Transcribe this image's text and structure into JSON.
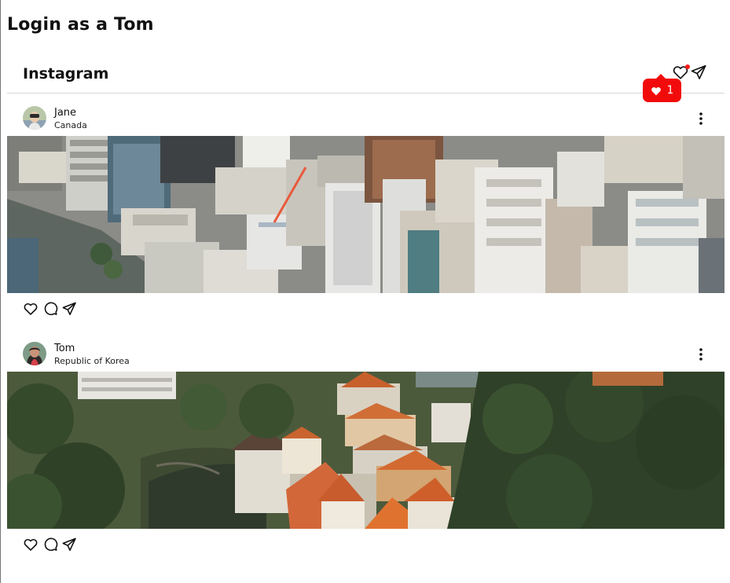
{
  "page": {
    "heading": "Login as a Tom"
  },
  "app": {
    "title": "Instagram",
    "icons": [
      "heart-icon",
      "send-icon"
    ],
    "notification": {
      "count": "1",
      "color": "#f20b0b",
      "has_unread_dot": true
    }
  },
  "posts": [
    {
      "username": "Jane",
      "location": "Canada",
      "photo": "aerial view of downtown skyscrapers",
      "actions": [
        "like-icon",
        "comment-icon",
        "share-icon"
      ]
    },
    {
      "username": "Tom",
      "location": "Republic of Korea",
      "photo": "aerial view of old town red roofs with river and trees",
      "actions": [
        "like-icon",
        "comment-icon",
        "share-icon"
      ]
    }
  ]
}
